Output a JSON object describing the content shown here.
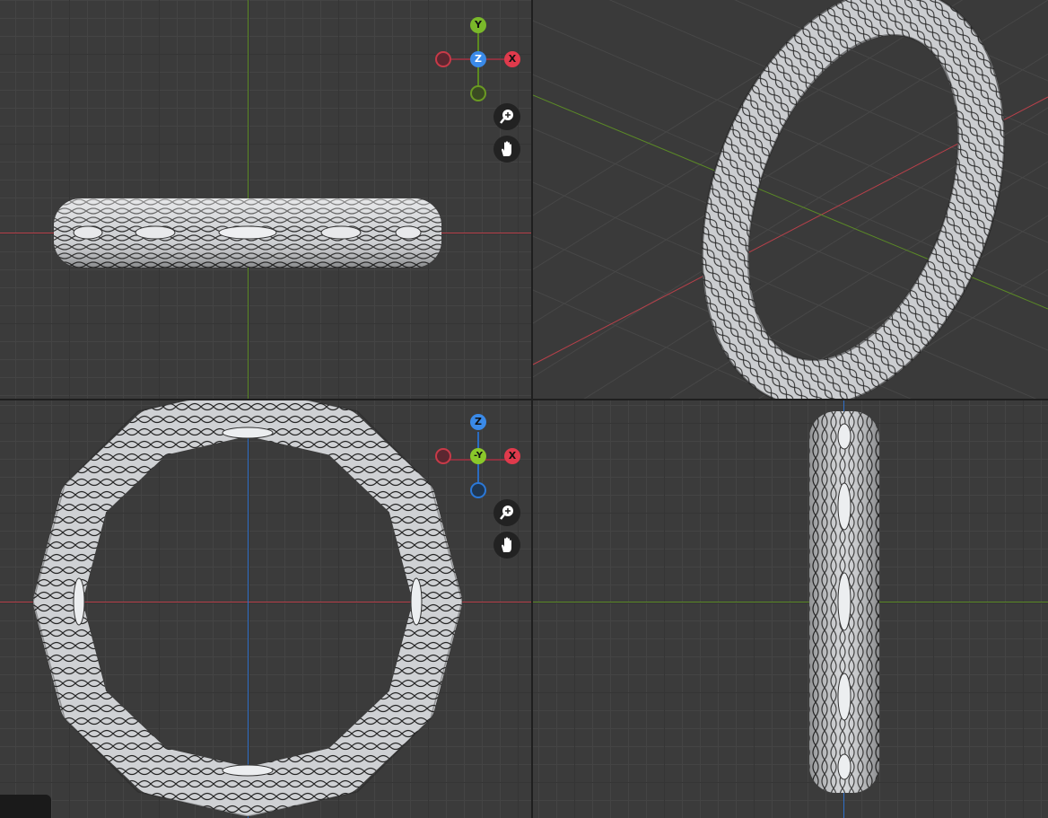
{
  "gizmo_top": {
    "up": "Y",
    "center": "Z",
    "right": "X"
  },
  "gizmo_front": {
    "up": "Z",
    "center": "-Y",
    "right": "X"
  },
  "icons": {
    "zoom": "zoom-in-icon",
    "pan": "hand-pan-icon"
  },
  "colors": {
    "x_axis": "#d23a48",
    "y_axis": "#6a9a22",
    "z_axis": "#2a78d8",
    "ring": "#c7c9cc"
  }
}
